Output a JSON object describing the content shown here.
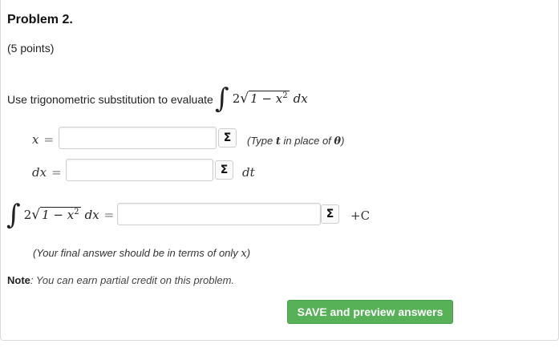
{
  "problem": {
    "title": "Problem 2.",
    "points": "(5 points)",
    "prompt": "Use trigonometric substitution to evaluate"
  },
  "integral": {
    "symbol": "∫",
    "coef": "2",
    "radicand": "1 − x",
    "exponent": "2",
    "dvar": "dx"
  },
  "fields": {
    "x_label": "x",
    "dx_label": "dx",
    "eq": "=",
    "x_hint_pre": "(Type ",
    "x_hint_t": "t",
    "x_hint_mid": " in place of ",
    "x_hint_theta": "θ",
    "x_hint_post": ")",
    "dx_after": "dt",
    "integral_after": "+C",
    "x_value": "",
    "dx_value": "",
    "integral_value": ""
  },
  "sigma_icon": "Σ",
  "final_note_pre": "(Your final answer should be in terms of only ",
  "final_note_var": "x",
  "final_note_post": ")",
  "note": {
    "label": "Note",
    "text": ": You can earn partial credit on this problem."
  },
  "save_button": "SAVE and preview answers",
  "colors": {
    "button_green": "#57b157"
  }
}
